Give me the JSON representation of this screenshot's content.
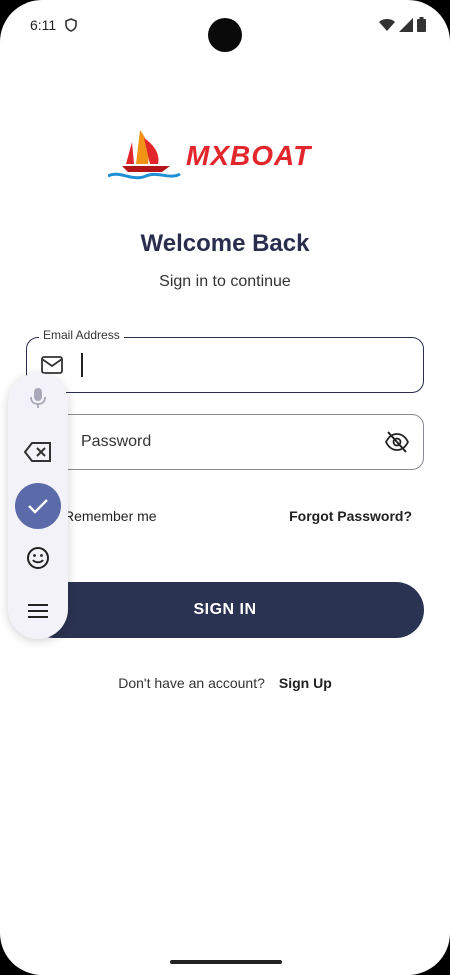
{
  "status_bar": {
    "time": "6:11",
    "icons": [
      "shield-icon",
      "wifi-icon",
      "signal-icon",
      "battery-icon"
    ]
  },
  "logo": {
    "text": "MXBOAT",
    "colors": {
      "text": "#e2262b",
      "sail": "#f29318",
      "water": "#1f8fd6"
    }
  },
  "header": {
    "title": "Welcome Back",
    "subtitle": "Sign in to continue"
  },
  "email": {
    "label": "Email Address",
    "value": "",
    "icon": "mail-icon"
  },
  "password": {
    "placeholder": "Password",
    "icon": "lock-icon",
    "toggle_icon": "eye-off-icon"
  },
  "options": {
    "remember_label": "Remember me",
    "forgot_label": "Forgot Password?"
  },
  "signin": {
    "label": "SIGN IN",
    "color": "#2b3352"
  },
  "signup": {
    "prompt": "Don't have an account?",
    "link": "Sign Up"
  },
  "keyboard_toolbar": {
    "items": [
      "microphone-icon",
      "backspace-icon",
      "check-icon",
      "emoji-icon",
      "menu-icon"
    ]
  }
}
